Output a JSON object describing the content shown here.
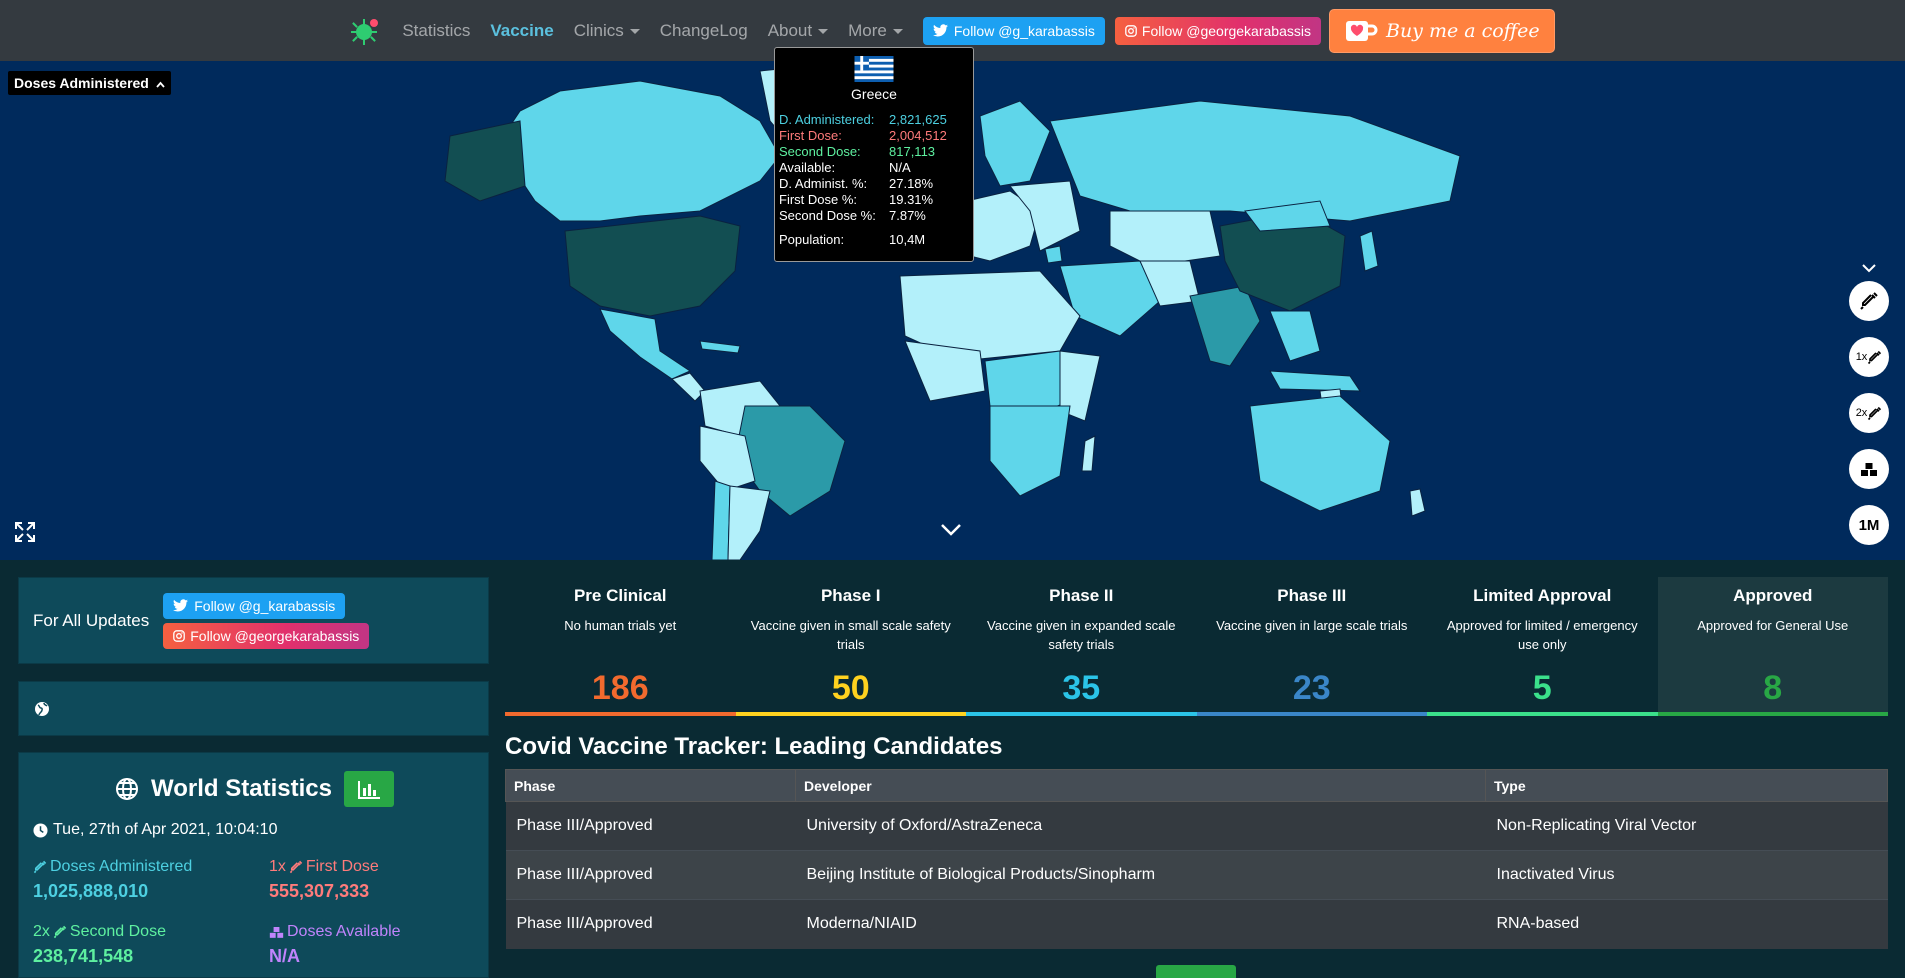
{
  "nav": {
    "links": [
      {
        "label": "Statistics",
        "active": false,
        "dropdown": false
      },
      {
        "label": "Vaccine",
        "active": true,
        "dropdown": false
      },
      {
        "label": "Clinics",
        "active": false,
        "dropdown": true
      },
      {
        "label": "ChangeLog",
        "active": false,
        "dropdown": false
      },
      {
        "label": "About",
        "active": false,
        "dropdown": true
      },
      {
        "label": "More",
        "active": false,
        "dropdown": true
      }
    ],
    "twitter_label": "Follow @g_karabassis",
    "instagram_label": "Follow @georgekarabassis",
    "coffee_label": "Buy me a coffee"
  },
  "map": {
    "layer_selector": "Doses Administered",
    "side_buttons": [
      "syringe-icon",
      "1x",
      "2x",
      "boxes-icon",
      "1M"
    ],
    "tooltip": {
      "country": "Greece",
      "rows": [
        {
          "key": "D. Administered:",
          "value": "2,821,625",
          "kind": "admin"
        },
        {
          "key": "First Dose:",
          "value": "2,004,512",
          "kind": "first"
        },
        {
          "key": "Second Dose:",
          "value": "817,113",
          "kind": "second"
        },
        {
          "key": "Available:",
          "value": "N/A",
          "kind": "plain"
        },
        {
          "key": "D. Administ. %:",
          "value": "27.18%",
          "kind": "plain"
        },
        {
          "key": "First Dose %:",
          "value": "19.31%",
          "kind": "plain"
        },
        {
          "key": "Second Dose %:",
          "value": "7.87%",
          "kind": "plain"
        }
      ],
      "population_key": "Population:",
      "population_value": "10,4M"
    },
    "colors": {
      "ocean": "#002a5c",
      "light": "#b3f0fa",
      "mid": "#5fd6ea",
      "deep": "#2b9aa8",
      "darkest": "#124e52"
    }
  },
  "follow_card": {
    "label": "For All Updates",
    "twitter_label": "Follow @g_karabassis",
    "instagram_label": "Follow @georgekarabassis"
  },
  "world": {
    "title": "World Statistics",
    "date": "Tue, 27th of Apr 2021, 10:04:10",
    "stats": [
      {
        "label": "Doses Administered",
        "prefix": "",
        "value": "1,025,888,010",
        "kind": "admin"
      },
      {
        "label": "First Dose",
        "prefix": "1x",
        "value": "555,307,333",
        "kind": "first"
      },
      {
        "label": "Second Dose",
        "prefix": "2x",
        "value": "238,741,548",
        "kind": "second"
      },
      {
        "label": "Doses Available",
        "prefix": "",
        "value": "N/A",
        "kind": "avail"
      }
    ]
  },
  "phases": [
    {
      "title": "Pre Clinical",
      "desc": "No human trials yet",
      "count": "186",
      "color": "#f26a2e",
      "selected": false
    },
    {
      "title": "Phase I",
      "desc": "Vaccine given in small scale safety trials",
      "count": "50",
      "color": "#ffd21f",
      "selected": false
    },
    {
      "title": "Phase II",
      "desc": "Vaccine given in expanded scale safety trials",
      "count": "35",
      "color": "#2bc4e8",
      "selected": false
    },
    {
      "title": "Phase III",
      "desc": "Vaccine given in large scale trials",
      "count": "23",
      "color": "#3a86c8",
      "selected": false
    },
    {
      "title": "Limited Approval",
      "desc": "Approved for limited / emergency use only",
      "count": "5",
      "color": "#3be08b",
      "selected": false
    },
    {
      "title": "Approved",
      "desc": "Approved for General Use",
      "count": "8",
      "color": "#28a745",
      "selected": true
    }
  ],
  "table": {
    "title": "Covid Vaccine Tracker: Leading Candidates",
    "headers": [
      "Phase",
      "Developer",
      "Type"
    ],
    "rows": [
      [
        "Phase III/Approved",
        "University of Oxford/AstraZeneca",
        "Non-Replicating Viral Vector"
      ],
      [
        "Phase III/Approved",
        "Beijing Institute of Biological Products/Sinopharm",
        "Inactivated Virus"
      ],
      [
        "Phase III/Approved",
        "Moderna/NIAID",
        "RNA-based"
      ]
    ]
  }
}
